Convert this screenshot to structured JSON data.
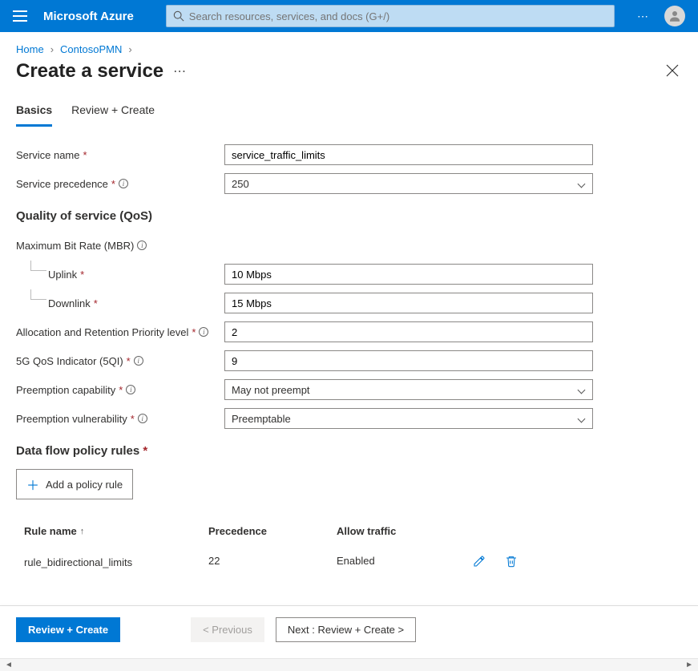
{
  "header": {
    "brand": "Microsoft Azure",
    "search_placeholder": "Search resources, services, and docs (G+/)"
  },
  "breadcrumb": {
    "items": [
      "Home",
      "ContosoPMN"
    ]
  },
  "page": {
    "title": "Create a service"
  },
  "tabs": [
    {
      "label": "Basics",
      "active": true
    },
    {
      "label": "Review + Create",
      "active": false
    }
  ],
  "form": {
    "service_name_label": "Service name",
    "service_name_value": "service_traffic_limits",
    "service_precedence_label": "Service precedence",
    "service_precedence_value": "250",
    "qos_header": "Quality of service (QoS)",
    "mbr_label": "Maximum Bit Rate (MBR)",
    "uplink_label": "Uplink",
    "uplink_value": "10 Mbps",
    "downlink_label": "Downlink",
    "downlink_value": "15 Mbps",
    "arp_label": "Allocation and Retention Priority level",
    "arp_value": "2",
    "fgqi_label": "5G QoS Indicator (5QI)",
    "fgqi_value": "9",
    "preempt_cap_label": "Preemption capability",
    "preempt_cap_value": "May not preempt",
    "preempt_vuln_label": "Preemption vulnerability",
    "preempt_vuln_value": "Preemptable",
    "rules_header": "Data flow policy rules",
    "add_rule_label": "Add a policy rule"
  },
  "rules_table": {
    "columns": {
      "name": "Rule name",
      "precedence": "Precedence",
      "allow": "Allow traffic"
    },
    "rows": [
      {
        "name": "rule_bidirectional_limits",
        "precedence": "22",
        "allow": "Enabled"
      }
    ]
  },
  "footer": {
    "review_create": "Review + Create",
    "previous": "< Previous",
    "next": "Next : Review + Create >"
  }
}
